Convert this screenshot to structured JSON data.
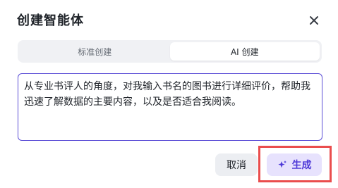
{
  "dialog": {
    "title": "创建智能体",
    "close_icon": "close-icon"
  },
  "tabs": [
    {
      "label": "标准创建",
      "active": false
    },
    {
      "label": "AI 创建",
      "active": true
    }
  ],
  "prompt": {
    "value": "从专业书评人的角度，对我输入书名的图书进行详细评价，帮助我迅速了解数据的主要内容，以及是否适合我阅读。"
  },
  "footer": {
    "cancel_label": "取消",
    "generate_label": "生成",
    "generate_icon": "sparkle-icon"
  },
  "colors": {
    "accent": "#5b4ed6",
    "generate_bg": "#e7e2fd",
    "highlight": "#ea4d4d"
  }
}
